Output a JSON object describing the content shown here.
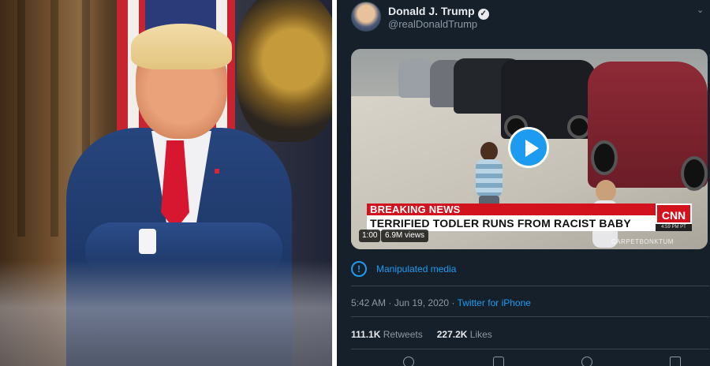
{
  "tweet": {
    "author_name": "Donald J. Trump",
    "handle": "@realDonaldTrump",
    "verified_icon": "check-icon",
    "verified_glyph": "✓",
    "more_icon": "chevron-down-icon",
    "more_glyph": "⌄",
    "video": {
      "banner_label": "BREAKING NEWS",
      "headline": "TERRIFIED TODLER RUNS FROM RACIST BABY",
      "network_logo": "CNN",
      "network_time": "4:59 PM PT",
      "watermark": "CARPETBONKTUM",
      "duration": "1:00",
      "views": "6.9M views",
      "play_icon": "play-icon",
      "play_color": "#1d9bf0"
    },
    "label": {
      "icon": "info-icon",
      "glyph": "!",
      "text": "Manipulated media"
    },
    "meta": {
      "time": "5:42 AM",
      "separator": " · ",
      "date": "Jun 19, 2020",
      "source": "Twitter for iPhone"
    },
    "stats": {
      "retweets_count": "111.1K",
      "retweets_label": "Retweets",
      "likes_count": "227.2K",
      "likes_label": "Likes"
    },
    "actions": [
      "reply-icon",
      "retweet-icon",
      "like-icon",
      "share-icon"
    ]
  },
  "colors": {
    "background": "#15202b",
    "accent": "#1d9bf0",
    "banner_red": "#d2121d",
    "muted_text": "#8b98a5"
  }
}
